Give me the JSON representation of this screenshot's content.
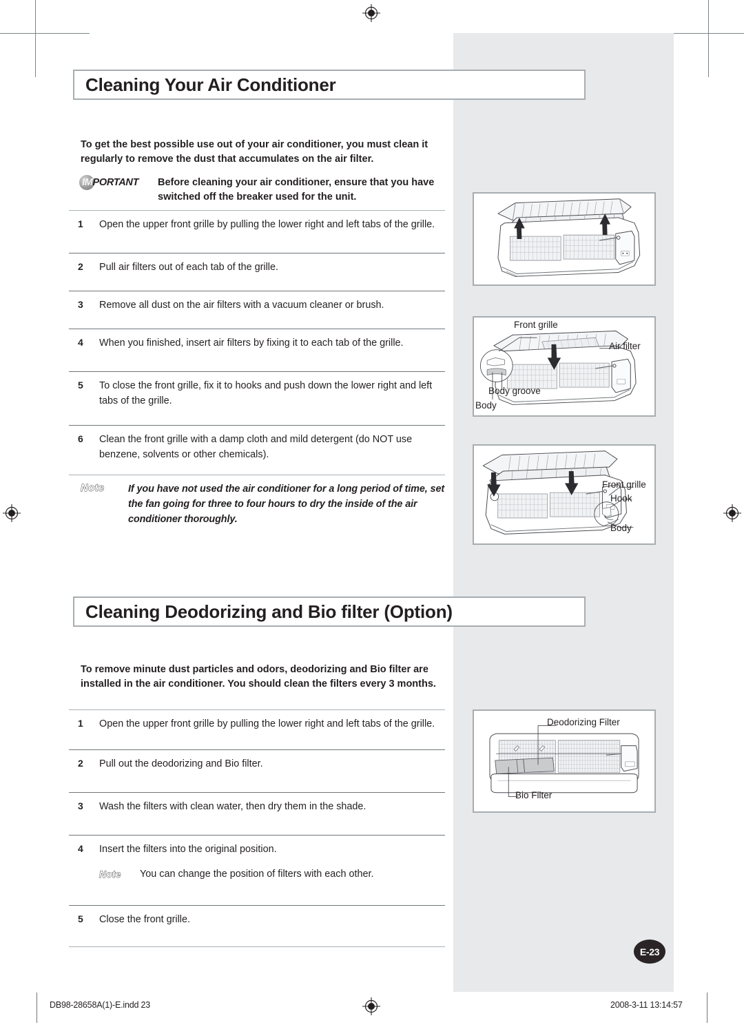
{
  "document": {
    "page_badge": "E-23",
    "footer": {
      "file_name": "DB98-28658A(1)-E.indd   23",
      "timestamp": "2008-3-11   13:14:57"
    }
  },
  "section1": {
    "heading": "Cleaning Your Air Conditioner",
    "intro": "To get the best possible use out of your air conditioner, you must clean it regularly to remove the dust that accumulates on the air filter.",
    "important": {
      "tag_prefix": "IM",
      "tag_suffix": "PORTANT",
      "text": "Before cleaning your air conditioner, ensure that you have switched off the breaker used for the unit."
    },
    "steps": [
      {
        "num": "1",
        "text": "Open the upper front grille by pulling the lower right and left tabs of the grille."
      },
      {
        "num": "2",
        "text": "Pull air filters out of each tab of the grille."
      },
      {
        "num": "3",
        "text": "Remove all dust on the air filters with a vacuum cleaner or brush."
      },
      {
        "num": "4",
        "text": "When you finished, insert air filters by fixing it to each tab of the grille."
      },
      {
        "num": "5",
        "text": "To close the front grille, fix it to hooks and push down the lower right and left tabs of the grille."
      },
      {
        "num": "6",
        "text": "Clean the front grille with a damp cloth and mild detergent (do NOT use benzene, solvents or other chemicals)."
      }
    ],
    "note": {
      "tag": "Note",
      "text": "If you have not used the air conditioner for a long period of time, set the fan going for three to four hours to dry the inside of the air conditioner thoroughly."
    }
  },
  "section2": {
    "heading": "Cleaning Deodorizing and Bio filter (Option)",
    "intro": "To remove minute dust particles and odors, deodorizing and Bio filter are installed in the air conditioner. You should clean the filters every 3 months.",
    "steps": [
      {
        "num": "1",
        "text": "Open the upper front grille by pulling the lower right and left tabs of the grille."
      },
      {
        "num": "2",
        "text": "Pull out the deodorizing and Bio filter."
      },
      {
        "num": "3",
        "text": "Wash the filters with clean water, then dry them in the shade."
      },
      {
        "num": "4",
        "text": "Insert the filters into the original position."
      },
      {
        "num": "5",
        "text": "Close the front grille."
      }
    ],
    "note": {
      "tag": "Note",
      "text": "You can change the position of filters with each other."
    }
  },
  "figures": {
    "fig1": {
      "caption_labels": []
    },
    "fig2": {
      "label_front_grille": "Front grille",
      "label_air_filter": "Air filter",
      "label_body_groove": "Body groove",
      "label_body": "Body"
    },
    "fig3": {
      "label_front_grille": "Front grille",
      "label_hook": "Hook",
      "label_body": "Body"
    },
    "fig4": {
      "label_deodorizing_filter": "Deodorizing Filter",
      "label_bio_filter": "Bio Filter"
    }
  },
  "colors": {
    "panel_grey": "#e7e9ea",
    "rule_dark": "#6f7579",
    "rule_light": "#a9b0b4",
    "border": "#a6adb1",
    "text": "#231f20",
    "badge_dark": "#2b2426"
  }
}
